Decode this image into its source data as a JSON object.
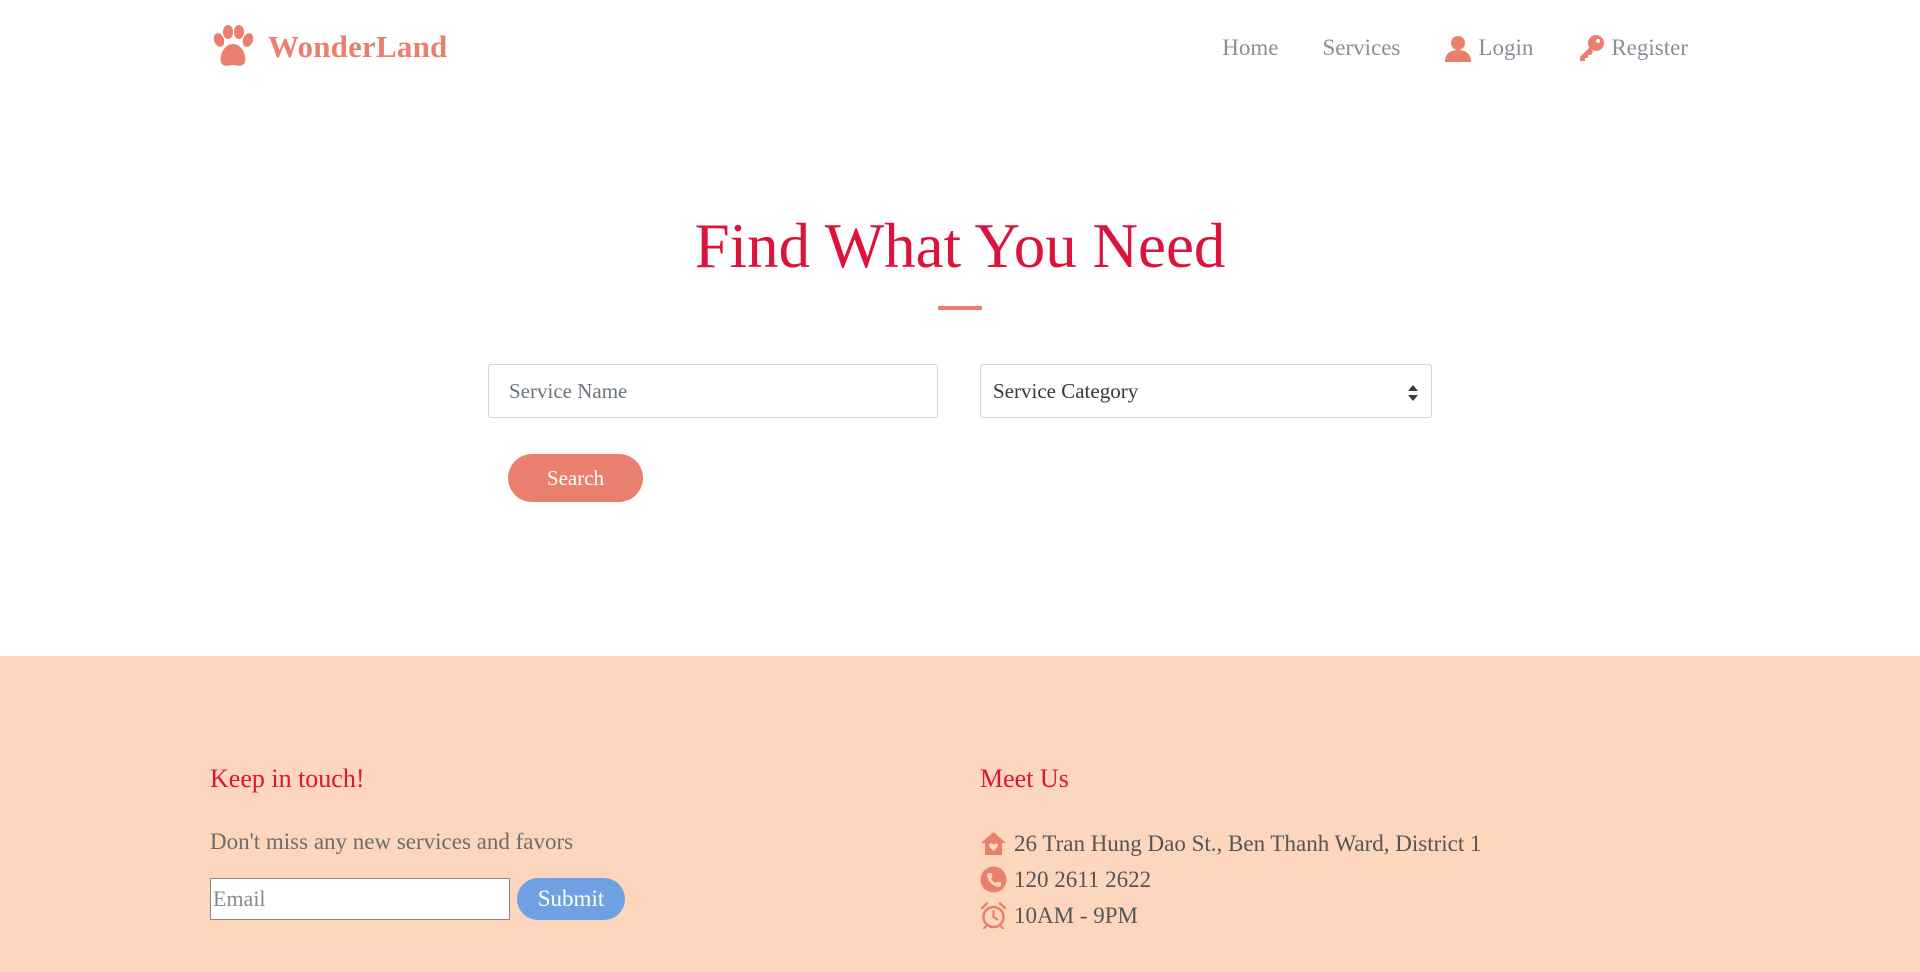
{
  "brand": {
    "name": "WonderLand",
    "icon": "paw-icon"
  },
  "nav": {
    "items": [
      {
        "label": "Home"
      },
      {
        "label": "Services"
      },
      {
        "label": "Login",
        "icon": "user-icon"
      },
      {
        "label": "Register",
        "icon": "key-icon"
      }
    ]
  },
  "hero": {
    "title": "Find What You Need"
  },
  "search": {
    "name_placeholder": "Service Name",
    "category_selected": "Service Category",
    "button_label": "Search"
  },
  "footer": {
    "newsletter": {
      "heading": "Keep in touch!",
      "text": "Don't miss any new services and favors",
      "email_placeholder": "Email",
      "submit_label": "Submit"
    },
    "meet": {
      "heading": "Meet Us",
      "address": "26 Tran Hung Dao St., Ben Thanh Ward, District 1",
      "phone": "120 2611 2622",
      "hours": "10AM - 9PM"
    }
  },
  "colors": {
    "accent": "#e9806e",
    "title": "#dc143c",
    "footer_bg": "#fdd7bd",
    "submit": "#6fa0e3",
    "nav_text": "#8a8d9a"
  }
}
